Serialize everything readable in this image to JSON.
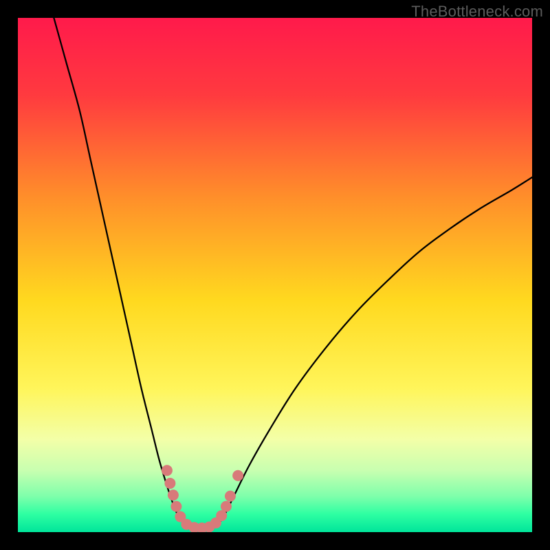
{
  "watermark": "TheBottleneck.com",
  "chart_data": {
    "type": "line",
    "title": "",
    "xlabel": "",
    "ylabel": "",
    "xlim": [
      0,
      100
    ],
    "ylim": [
      0,
      100
    ],
    "grid": false,
    "legend": false,
    "gradient_stops": [
      {
        "offset": 0.0,
        "color": "#ff1a4b"
      },
      {
        "offset": 0.15,
        "color": "#ff3a3f"
      },
      {
        "offset": 0.35,
        "color": "#ff8f2a"
      },
      {
        "offset": 0.55,
        "color": "#ffd91f"
      },
      {
        "offset": 0.72,
        "color": "#fff55a"
      },
      {
        "offset": 0.82,
        "color": "#f3ffa8"
      },
      {
        "offset": 0.88,
        "color": "#c8ffb0"
      },
      {
        "offset": 0.93,
        "color": "#7fffab"
      },
      {
        "offset": 0.965,
        "color": "#2effa2"
      },
      {
        "offset": 1.0,
        "color": "#00e59a"
      }
    ],
    "series": [
      {
        "name": "left-curve",
        "color": "#000000",
        "stroke_width": 2.3,
        "x": [
          7.0,
          9.5,
          12.0,
          14.0,
          16.0,
          18.0,
          20.0,
          22.0,
          24.0,
          26.0,
          27.5,
          29.0,
          30.0,
          31.0,
          32.0,
          33.0
        ],
        "y": [
          100.0,
          91.0,
          82.0,
          73.0,
          64.0,
          55.0,
          46.0,
          37.0,
          28.0,
          20.0,
          14.0,
          9.0,
          6.0,
          3.5,
          2.0,
          1.0
        ]
      },
      {
        "name": "right-curve",
        "color": "#000000",
        "stroke_width": 2.3,
        "x": [
          38.5,
          40.0,
          42.0,
          45.0,
          49.0,
          54.0,
          60.0,
          66.0,
          72.0,
          78.0,
          84.0,
          90.0,
          96.0,
          100.0
        ],
        "y": [
          1.0,
          3.0,
          7.0,
          13.0,
          20.0,
          28.0,
          36.0,
          43.0,
          49.0,
          54.5,
          59.0,
          63.0,
          66.5,
          69.0
        ]
      },
      {
        "name": "markers",
        "color": "#d87a7a",
        "marker_radius": 8,
        "points": [
          {
            "x": 29.0,
            "y": 12.0
          },
          {
            "x": 29.6,
            "y": 9.5
          },
          {
            "x": 30.2,
            "y": 7.2
          },
          {
            "x": 30.8,
            "y": 5.0
          },
          {
            "x": 31.6,
            "y": 3.0
          },
          {
            "x": 32.8,
            "y": 1.5
          },
          {
            "x": 34.3,
            "y": 0.9
          },
          {
            "x": 35.8,
            "y": 0.8
          },
          {
            "x": 37.2,
            "y": 1.0
          },
          {
            "x": 38.5,
            "y": 1.8
          },
          {
            "x": 39.6,
            "y": 3.2
          },
          {
            "x": 40.5,
            "y": 5.0
          },
          {
            "x": 41.3,
            "y": 7.0
          },
          {
            "x": 42.8,
            "y": 11.0
          }
        ]
      }
    ]
  }
}
